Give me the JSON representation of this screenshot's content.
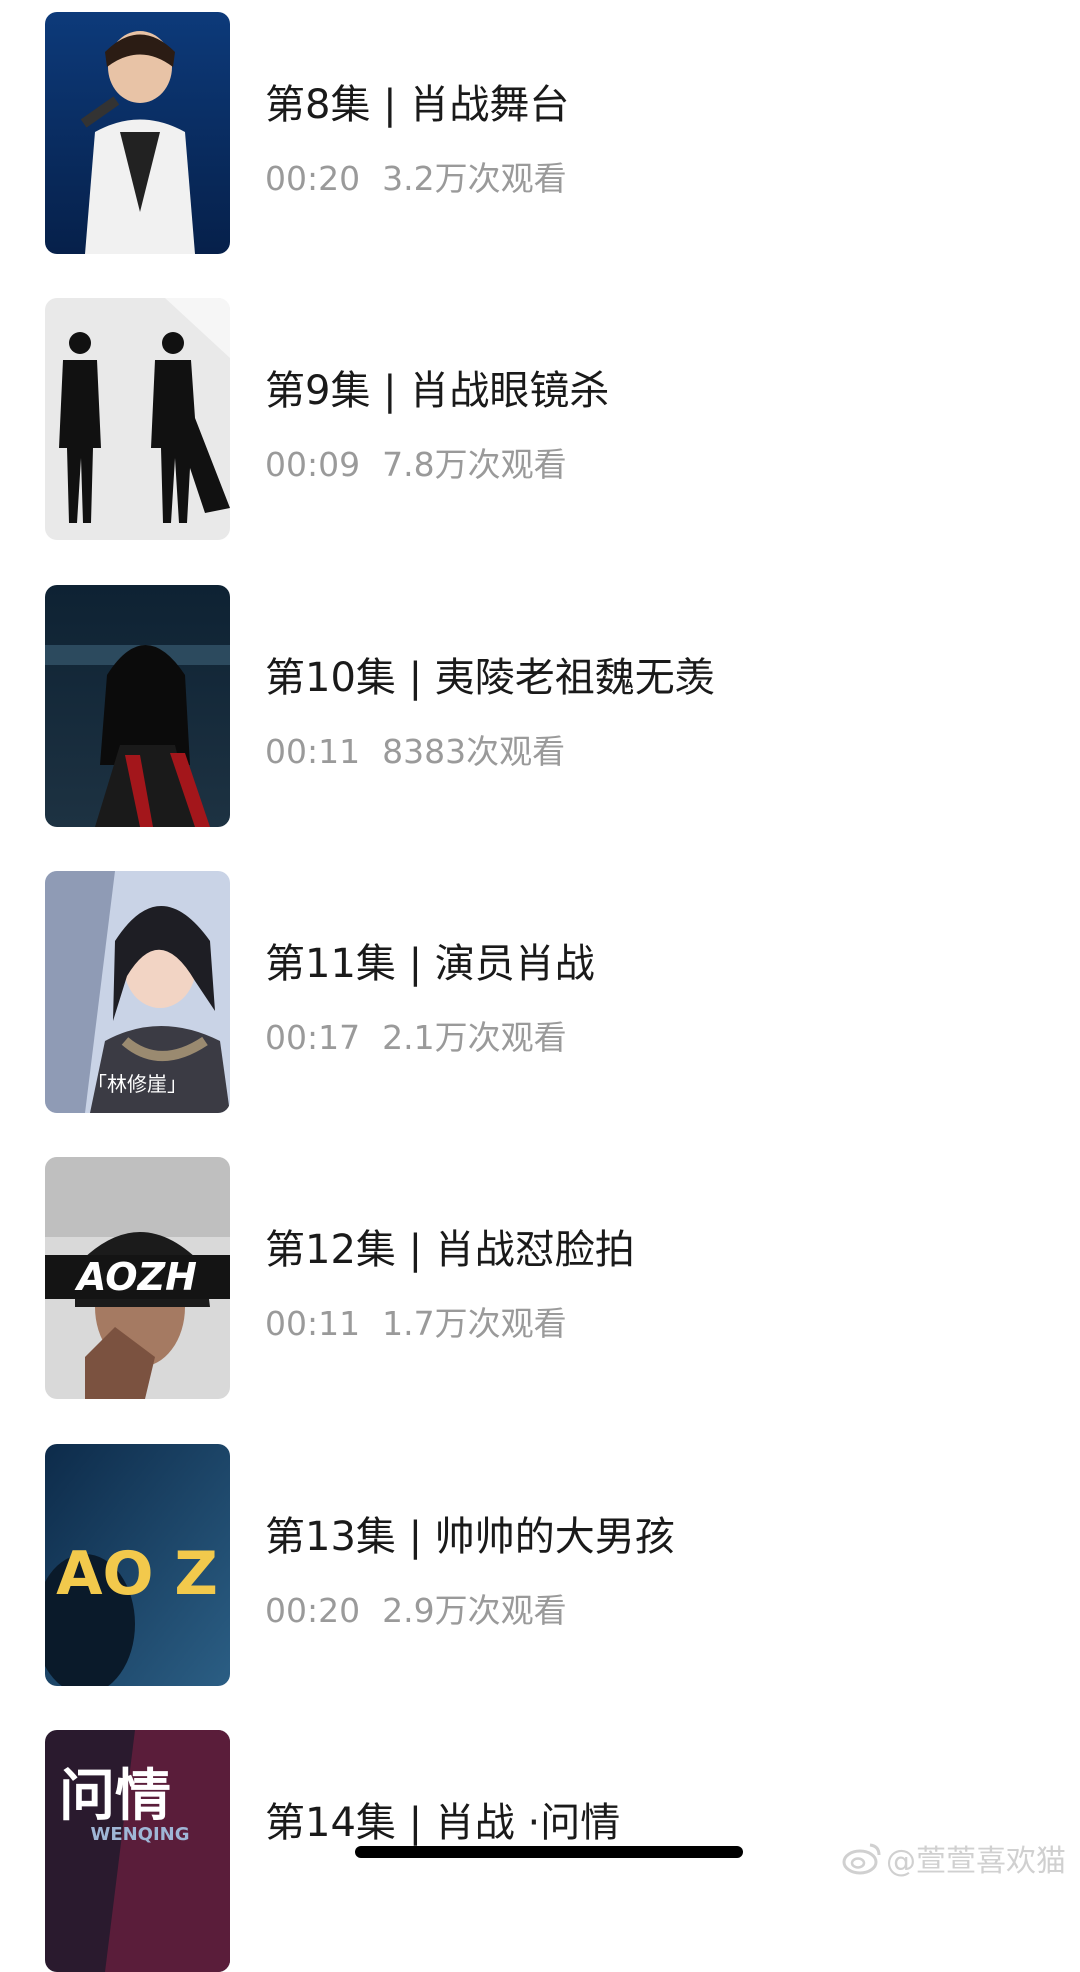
{
  "videos": [
    {
      "title": "第8集 | 肖战舞台",
      "duration": "00:20",
      "views": "3.2万次观看"
    },
    {
      "title": "第9集 | 肖战眼镜杀",
      "duration": "00:09",
      "views": "7.8万次观看"
    },
    {
      "title": "第10集 | 夷陵老祖魏无羡",
      "duration": "00:11",
      "views": "8383次观看"
    },
    {
      "title": "第11集 | 演员肖战",
      "duration": "00:17",
      "views": "2.1万次观看"
    },
    {
      "title": "第12集 | 肖战怼脸拍",
      "duration": "00:11",
      "views": "1.7万次观看"
    },
    {
      "title": "第13集 | 帅帅的大男孩",
      "duration": "00:20",
      "views": "2.9万次观看"
    },
    {
      "title": "第14集 | 肖战 ·问情",
      "duration": "",
      "views": ""
    }
  ],
  "thumbnails": {
    "ep11_caption": "「林修崖」",
    "ep12_overlay": "AOZH",
    "ep13_overlay": "AO Z",
    "ep14_overlay": "问情",
    "ep14_sub": "WENQING"
  },
  "watermark": {
    "icon": "weibo-icon",
    "text": "@萱萱喜欢猫"
  }
}
